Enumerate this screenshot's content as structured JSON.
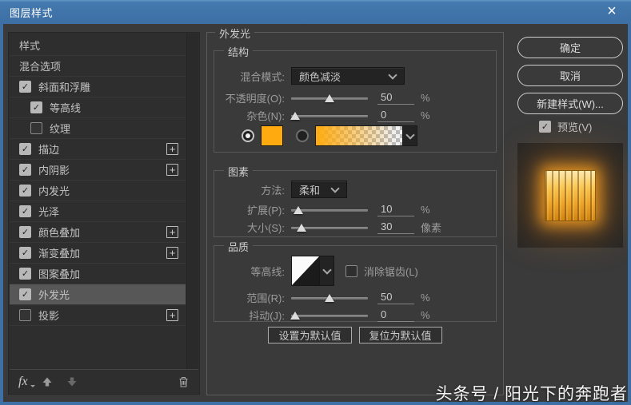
{
  "window": {
    "title": "图层样式",
    "close_icon": "×"
  },
  "glyphs": {
    "check": "✓",
    "plus": "+"
  },
  "colors": {
    "titlebar_blue": "#3E70A6",
    "swatch_orange": "#FFAB0F",
    "glow_orange": "#FFA622",
    "selected_row": "#575757"
  },
  "sidebar": {
    "items": [
      {
        "key": "styles",
        "label": "样式",
        "type": "plain"
      },
      {
        "key": "blending-options",
        "label": "混合选项",
        "type": "plain"
      },
      {
        "key": "bevel-emboss",
        "label": "斜面和浮雕",
        "checked": true
      },
      {
        "key": "contour",
        "label": "等高线",
        "checked": true,
        "indent": true
      },
      {
        "key": "texture",
        "label": "纹理",
        "checked": false,
        "indent": true
      },
      {
        "key": "stroke",
        "label": "描边",
        "checked": true,
        "plus": true
      },
      {
        "key": "inner-shadow",
        "label": "内阴影",
        "checked": true,
        "plus": true
      },
      {
        "key": "inner-glow",
        "label": "内发光",
        "checked": true
      },
      {
        "key": "satin",
        "label": "光泽",
        "checked": true
      },
      {
        "key": "color-overlay",
        "label": "颜色叠加",
        "checked": true,
        "plus": true
      },
      {
        "key": "gradient-overlay",
        "label": "渐变叠加",
        "checked": true,
        "plus": true
      },
      {
        "key": "pattern-overlay",
        "label": "图案叠加",
        "checked": true
      },
      {
        "key": "outer-glow",
        "label": "外发光",
        "checked": true,
        "selected": true
      },
      {
        "key": "drop-shadow",
        "label": "投影",
        "checked": false,
        "plus": true
      }
    ],
    "footer": {
      "fx_label": "fx"
    }
  },
  "panel": {
    "title": "外发光",
    "structure": {
      "legend": "结构",
      "blend_mode_label": "混合模式:",
      "blend_mode_value": "颜色减淡",
      "opacity_label": "不透明度(O):",
      "opacity_value": "50",
      "opacity_unit": "%",
      "noise_label": "杂色(N):",
      "noise_value": "0",
      "noise_unit": "%"
    },
    "elements": {
      "legend": "图素",
      "technique_label": "方法:",
      "technique_value": "柔和",
      "spread_label": "扩展(P):",
      "spread_value": "10",
      "spread_unit": "%",
      "size_label": "大小(S):",
      "size_value": "30",
      "size_unit": "像素"
    },
    "quality": {
      "legend": "品质",
      "contour_label": "等高线:",
      "antialias_label": "消除锯齿(L)",
      "range_label": "范围(R):",
      "range_value": "50",
      "range_unit": "%",
      "jitter_label": "抖动(J):",
      "jitter_value": "0",
      "jitter_unit": "%"
    },
    "footer_buttons": {
      "make_default": "设置为默认值",
      "reset_default": "复位为默认值"
    }
  },
  "actions": {
    "ok": "确定",
    "cancel": "取消",
    "new_style": "新建样式(W)...",
    "preview_label": "预览(V)"
  },
  "states": {
    "preview_checked": true,
    "antialias_checked": false
  },
  "sliders": {
    "opacity": 50,
    "noise": 5,
    "spread": 9,
    "size": 14,
    "range": 50,
    "jitter": 5
  },
  "watermark": "头条号 / 阳光下的奔跑者"
}
